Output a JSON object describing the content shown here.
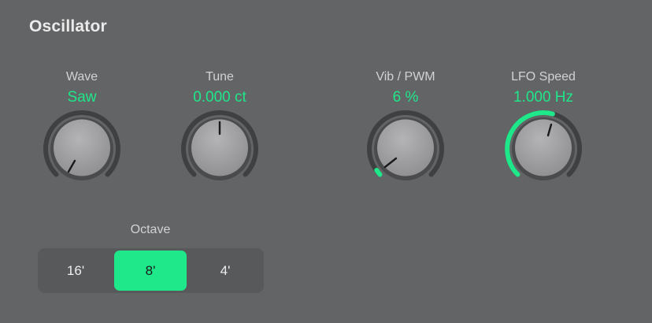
{
  "panel": {
    "title": "Oscillator"
  },
  "knobs": {
    "wave": {
      "label": "Wave",
      "value": "Saw"
    },
    "tune": {
      "label": "Tune",
      "value": "0.000 ct"
    },
    "vib": {
      "label": "Vib / PWM",
      "value": "6 %"
    },
    "lfo": {
      "label": "LFO Speed",
      "value": "1.000 Hz"
    }
  },
  "octave": {
    "label": "Octave",
    "options": [
      "16'",
      "8'",
      "4'"
    ],
    "selected": "8'"
  },
  "colors": {
    "background": "#636466",
    "accent": "#1ee88a",
    "track": "#3f4042",
    "knob_face": "#a4a4a6"
  }
}
